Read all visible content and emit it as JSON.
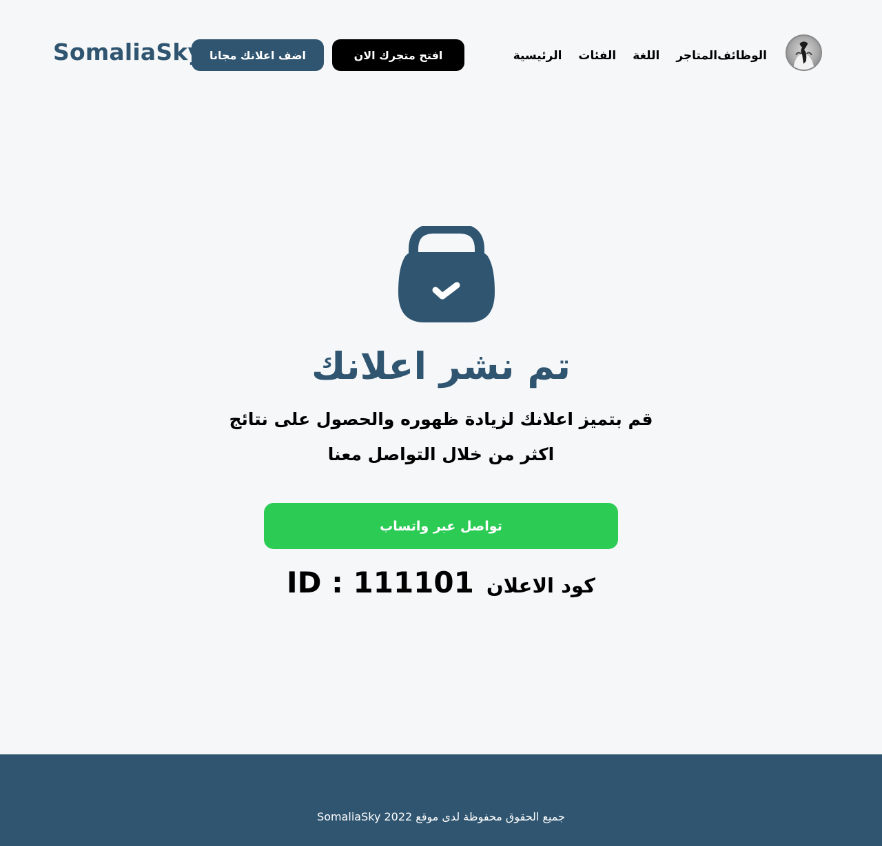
{
  "header": {
    "brand": "SomaliaSky",
    "add_ad_button": "اضف اعلانك مجانا",
    "open_store_button": "افتح متجرك الان",
    "nav": [
      {
        "label": "الرئيسية"
      },
      {
        "label": "الفئات"
      },
      {
        "label": "اللغة"
      },
      {
        "label": "المتاجر"
      },
      {
        "label": "الوظائف"
      }
    ],
    "avatar_icon": "user-avatar-icon"
  },
  "main": {
    "icon": "bag-check-icon",
    "title": "تم نشر اعلانك",
    "subtitle_line1": "قم بتميز اعلانك لزيادة ظهوره والحصول على نتائج",
    "subtitle_line2": "اكثر  من خلال التواصل معنا",
    "whatsapp_button": "تواصل عبر واتساب",
    "ad_code_label": "كود الاعلان",
    "ad_code_value": "ID : 111101"
  },
  "footer": {
    "copyright": "جميع الحقوق محفوظة لدى موقع SomaliaSky 2022"
  },
  "colors": {
    "primary": "#2f5570",
    "background": "#f6f7f9",
    "whatsapp": "#2bcb54",
    "black": "#000000"
  }
}
